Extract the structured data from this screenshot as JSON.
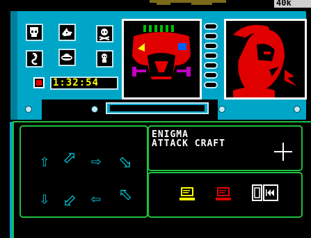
{
  "header": {
    "badge_text": "40k"
  },
  "console": {
    "timer": "1:32:54",
    "icons": [
      "skull-helmet-icon",
      "shark-icon",
      "skull-crossbones-icon",
      "seahorse-icon",
      "ufo-icon",
      "pawn-icon"
    ]
  },
  "info_panel": {
    "title_line1": "ENIGMA",
    "title_line2": "ATTACK CRAFT"
  },
  "arrows": {
    "row1": [
      "⇧",
      "⬀",
      "⇨",
      "⬂"
    ],
    "row2": [
      "⇩",
      "⬃",
      "⇦",
      "⬁"
    ]
  },
  "actions": {
    "items": [
      "yellow-terminal-icon",
      "red-terminal-icon",
      "rewind-door-icon"
    ]
  },
  "colors": {
    "console": "#00a6c8",
    "panel_border": "#20c040",
    "arrow": "#00d0e0",
    "timer": "#ffff00",
    "enemy_red": "#e00000"
  }
}
